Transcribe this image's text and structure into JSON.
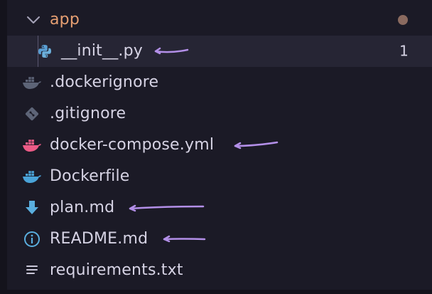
{
  "explorer": {
    "folder": {
      "label": "app",
      "expanded": true,
      "badge": "modified-dot",
      "badge_color": "#8a6a5f",
      "label_color": "#e69f72"
    },
    "items": [
      {
        "label": "__init__.py",
        "icon": "python-icon",
        "selected": true,
        "badge_count": "1",
        "annotated": true
      },
      {
        "label": ".dockerignore",
        "icon": "docker-icon",
        "annotated": false
      },
      {
        "label": ".gitignore",
        "icon": "git-icon",
        "annotated": false
      },
      {
        "label": "docker-compose.yml",
        "icon": "docker-compose-icon",
        "annotated": true
      },
      {
        "label": "Dockerfile",
        "icon": "docker-icon",
        "annotated": false
      },
      {
        "label": "plan.md",
        "icon": "markdown-download-icon",
        "annotated": true
      },
      {
        "label": "README.md",
        "icon": "info-icon",
        "annotated": true
      },
      {
        "label": "requirements.txt",
        "icon": "text-lines-icon",
        "annotated": false
      }
    ],
    "annotation_color": "#b38fe8"
  }
}
